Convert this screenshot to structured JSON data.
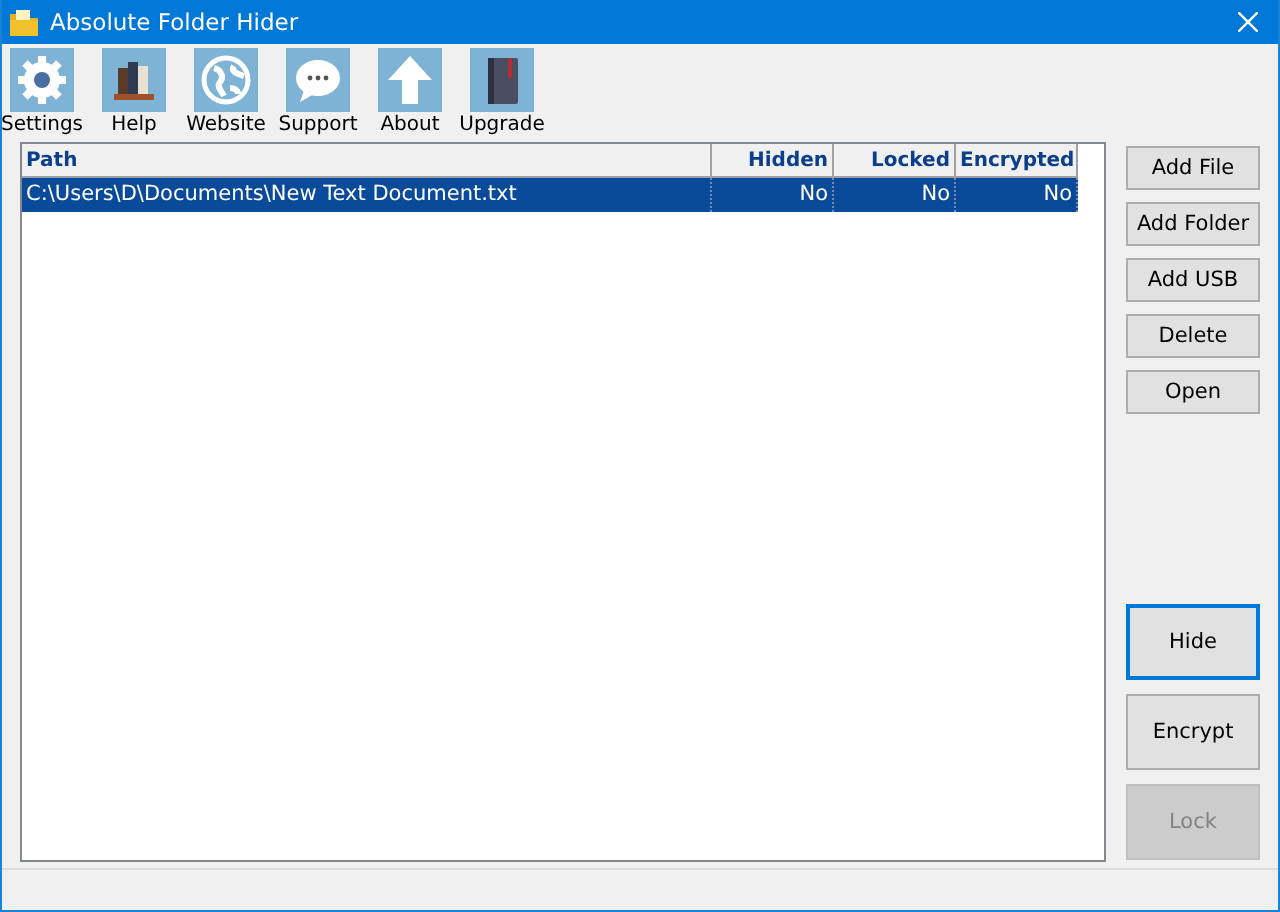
{
  "window": {
    "title": "Absolute Folder Hider"
  },
  "toolbar": [
    {
      "label": "Settings"
    },
    {
      "label": "Help"
    },
    {
      "label": "Website"
    },
    {
      "label": "Support"
    },
    {
      "label": "About"
    },
    {
      "label": "Upgrade"
    }
  ],
  "table": {
    "columns": [
      "Path",
      "Hidden",
      "Locked",
      "Encrypted"
    ],
    "rows": [
      {
        "selected": true,
        "cells": [
          "C:\\Users\\D\\Documents\\New Text Document.txt",
          "No",
          "No",
          "No"
        ]
      }
    ]
  },
  "buttons": [
    {
      "label": "Add File",
      "kind": "small",
      "disabled": false,
      "focused": false
    },
    {
      "label": "Add Folder",
      "kind": "small",
      "disabled": false,
      "focused": false
    },
    {
      "label": "Add USB",
      "kind": "small",
      "disabled": false,
      "focused": false
    },
    {
      "label": "Delete",
      "kind": "small",
      "disabled": false,
      "focused": false
    },
    {
      "label": "Open",
      "kind": "small",
      "disabled": false,
      "focused": false
    },
    {
      "label": "Hide",
      "kind": "large",
      "disabled": false,
      "focused": true
    },
    {
      "label": "Encrypt",
      "kind": "large",
      "disabled": false,
      "focused": false
    },
    {
      "label": "Lock",
      "kind": "large",
      "disabled": true,
      "focused": false
    }
  ]
}
